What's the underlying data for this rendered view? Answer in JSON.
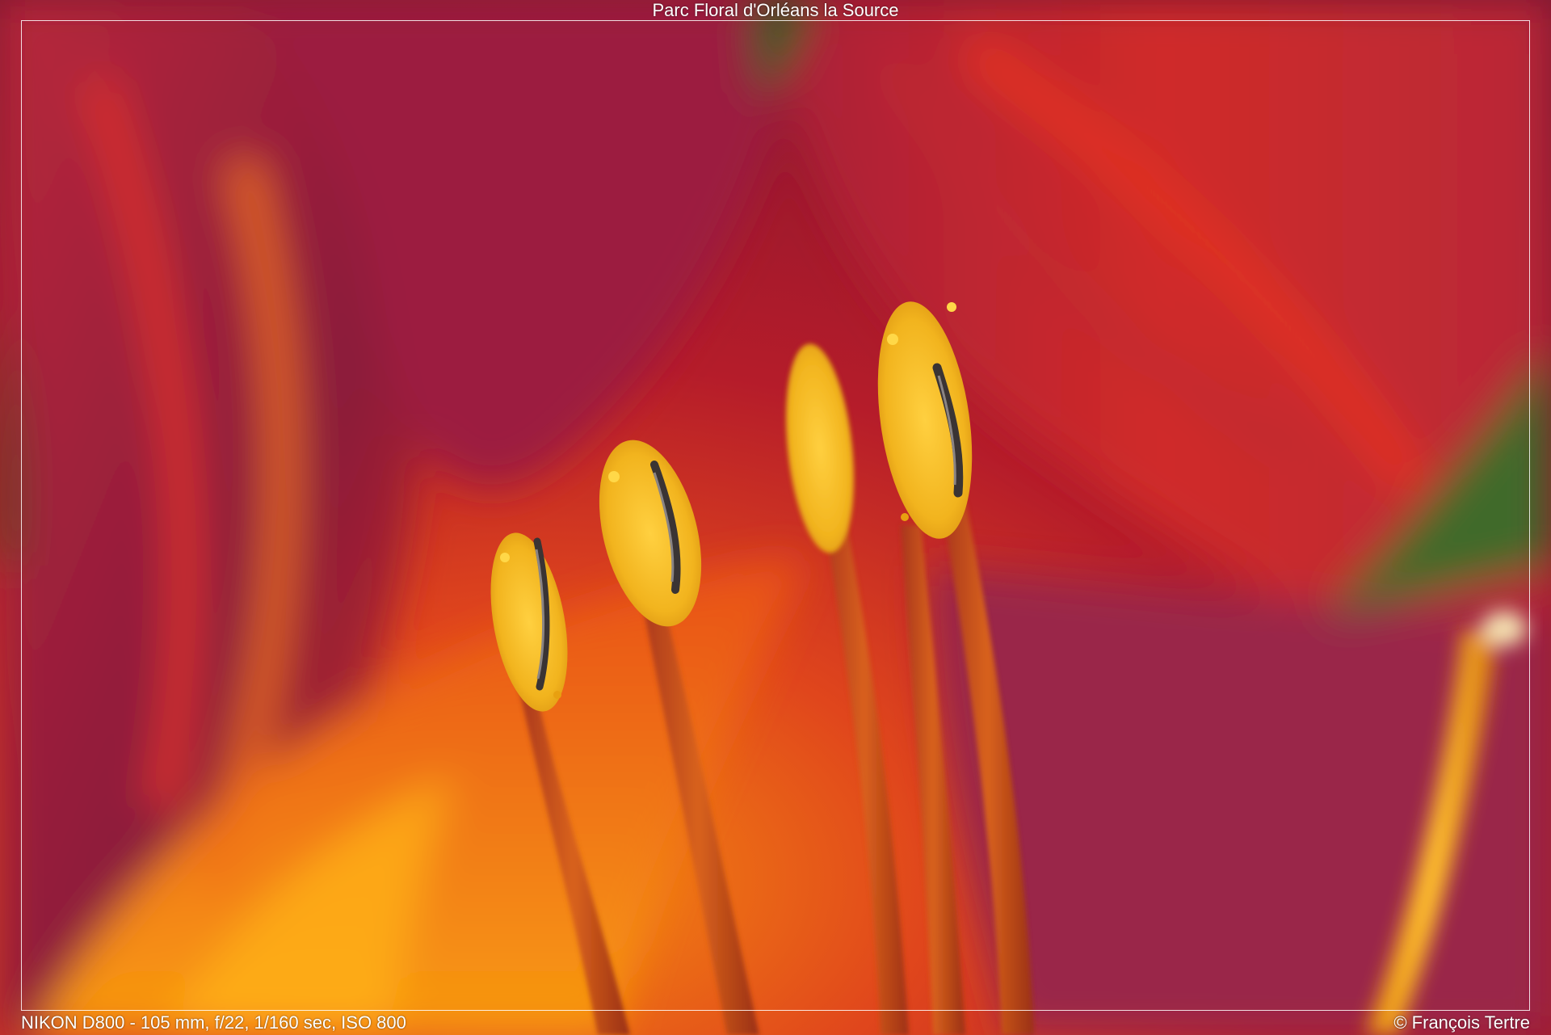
{
  "photo": {
    "title": "Parc Floral d'Orléans la Source",
    "exif": "NIKON D800 - 105 mm, f/22, 1/160 sec, ISO 800",
    "credit": "© François Tertre"
  },
  "colors": {
    "petal_dark": "#7a1422",
    "petal_red": "#c4202a",
    "petal_magenta": "#9a2a48",
    "throat_orange": "#f07a10",
    "filament": "#c8501a",
    "pollen": "#f2b41e",
    "leaf_green": "#3f6a2a",
    "frame_line": "#ffffff"
  }
}
